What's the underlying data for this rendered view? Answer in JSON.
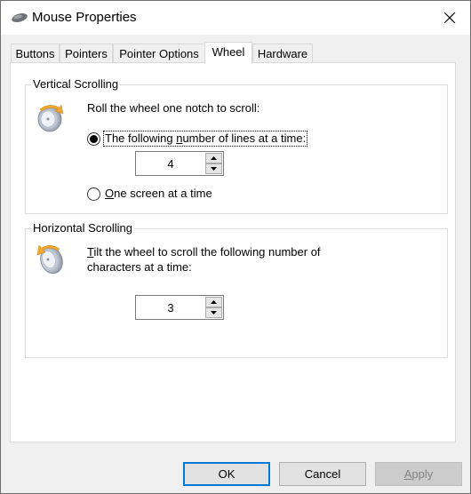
{
  "window": {
    "title": "Mouse Properties",
    "app_icon": "mouse-icon",
    "close_icon": "close-icon"
  },
  "tabs": [
    {
      "label": "Buttons",
      "active": false
    },
    {
      "label": "Pointers",
      "active": false
    },
    {
      "label": "Pointer Options",
      "active": false
    },
    {
      "label": "Wheel",
      "active": true
    },
    {
      "label": "Hardware",
      "active": false
    }
  ],
  "vertical_scrolling": {
    "title": "Vertical Scrolling",
    "icon": "vertical-wheel-icon",
    "instruction": "Roll the wheel one notch to scroll:",
    "option_lines": {
      "label_pre": "The following ",
      "label_accel": "n",
      "label_post": "umber of lines at a time:",
      "selected": true
    },
    "lines_value": "4",
    "option_screen": {
      "label_accel": "O",
      "label_post": "ne screen at a time",
      "selected": false
    }
  },
  "horizontal_scrolling": {
    "title": "Horizontal Scrolling",
    "icon": "horizontal-wheel-icon",
    "instruction_accel": "T",
    "instruction_line1": "ilt the wheel to scroll the following number of",
    "instruction_line2": "characters at a time:",
    "chars_value": "3"
  },
  "buttons": {
    "ok": "OK",
    "cancel": "Cancel",
    "apply_accel": "A",
    "apply_rest": "pply"
  },
  "colors": {
    "accent": "#0078d7",
    "dialog_bg": "#f0f0f0",
    "panel_bg": "#ffffff",
    "wheel_arrow": "#f0a830"
  }
}
